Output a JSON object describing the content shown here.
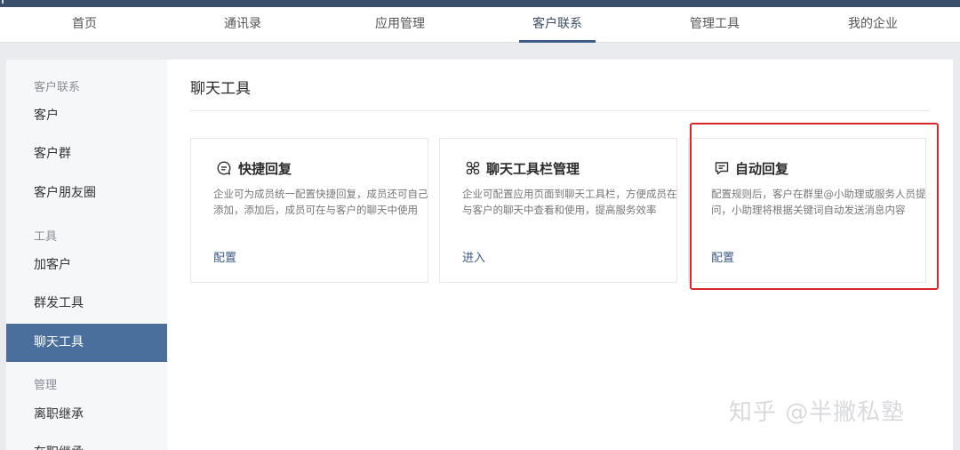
{
  "nav": {
    "items": [
      {
        "label": "首页"
      },
      {
        "label": "通讯录"
      },
      {
        "label": "应用管理"
      },
      {
        "label": "客户联系"
      },
      {
        "label": "管理工具"
      },
      {
        "label": "我的企业"
      }
    ],
    "active_index": 3
  },
  "sidebar": {
    "cat_customer": "客户联系",
    "customer": "客户",
    "customer_group": "客户群",
    "moments": "客户朋友圈",
    "cat_tools": "工具",
    "add_customer": "加客户",
    "mass_send": "群发工具",
    "chat_tools": "聊天工具",
    "cat_manage": "管理",
    "resign_inherit": "离职继承",
    "onjob_inherit": "在职继承"
  },
  "main": {
    "title": "聊天工具",
    "cards": [
      {
        "icon": "chat-bubble-lines-icon",
        "title": "快捷回复",
        "desc": "企业可为成员统一配置快捷回复，成员还可自己添加，添加后，成员可在与客户的聊天中使用",
        "action": "配置"
      },
      {
        "icon": "toolbar-grid-icon",
        "title": "聊天工具栏管理",
        "desc": "企业可配置应用页面到聊天工具栏，方便成员在与客户的聊天中查看和使用，提高服务效率",
        "action": "进入"
      },
      {
        "icon": "auto-reply-icon",
        "title": "自动回复",
        "desc": "配置规则后，客户在群里@小助理或服务人员提问，小助理将根据关键词自动发送消息内容",
        "action": "配置"
      }
    ]
  },
  "watermark": "知乎 @半撇私塾",
  "colors": {
    "accent": "#3c5a86",
    "sidebar_active": "#4a6f9c",
    "highlight": "#d9262a"
  }
}
